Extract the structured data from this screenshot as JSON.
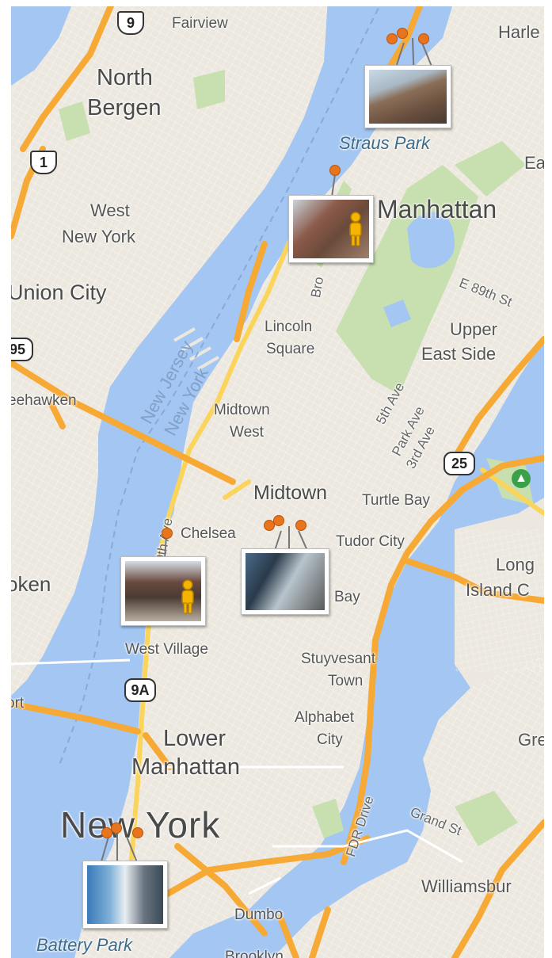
{
  "map": {
    "colors": {
      "water": "#a3c6f2",
      "land": "#ece8df",
      "park": "#c8dfb0",
      "highway": "#f7a935",
      "arterial": "#fbd55b",
      "pin": "#e8741e"
    },
    "labels": {
      "fairview": "Fairview",
      "north_bergen_1": "North",
      "north_bergen_2": "Bergen",
      "west_ny_1": "West",
      "west_ny_2": "New York",
      "union_city": "Union City",
      "weehawken": "eehawken",
      "hoboken": "oken",
      "harlem": "Harle",
      "east_harlem": "Ea",
      "manhattan": "Manhattan",
      "e89": "E 89th St",
      "broadway": "Bro",
      "lincoln_1": "Lincoln",
      "lincoln_2": "Square",
      "ues_1": "Upper",
      "ues_2": "East Side",
      "fifth": "5th Ave",
      "park": "Park Ave",
      "third": "3rd Ave",
      "nj": "New Jersey",
      "ny": "New York",
      "midtown_west_1": "Midtown",
      "midtown_west_2": "West",
      "midtown": "Midtown",
      "turtle_bay": "Turtle Bay",
      "tenth": "0th Ave",
      "chelsea": "Chelsea",
      "tudor": "Tudor City",
      "long_1": "Long",
      "long_2": "Island C",
      "bay": "Bay",
      "west_village": "West Village",
      "stuy_1": "Stuyvesant",
      "stuy_2": "Town",
      "port": "ort",
      "alphabet_1": "Alphabet",
      "alphabet_2": "City",
      "greenpoint": "Gre",
      "lower_1": "Lower",
      "lower_2": "Manhattan",
      "fdr": "FDR Drive",
      "grand": "Grand St",
      "new_york": "New York",
      "williamsburg": "Williamsbur",
      "dumbo": "Dumbo",
      "brooklyn": "Brooklyn",
      "straus": "Straus Park",
      "battery": "Battery Park",
      "route_9": "9",
      "route_1": "1",
      "route_495": "95",
      "route_25": "25",
      "route_9a": "9A"
    },
    "photo_groups": [
      {
        "name": "straus-park",
        "caption": "Straus Park"
      },
      {
        "name": "upper-west-streetview",
        "caption": ""
      },
      {
        "name": "chelsea-streetview",
        "caption": ""
      },
      {
        "name": "murray-hill",
        "caption": ""
      },
      {
        "name": "battery-park",
        "caption": "Battery Park"
      }
    ],
    "icons": [
      "pegman-icon",
      "pegman-icon",
      "park-tree-icon"
    ]
  }
}
